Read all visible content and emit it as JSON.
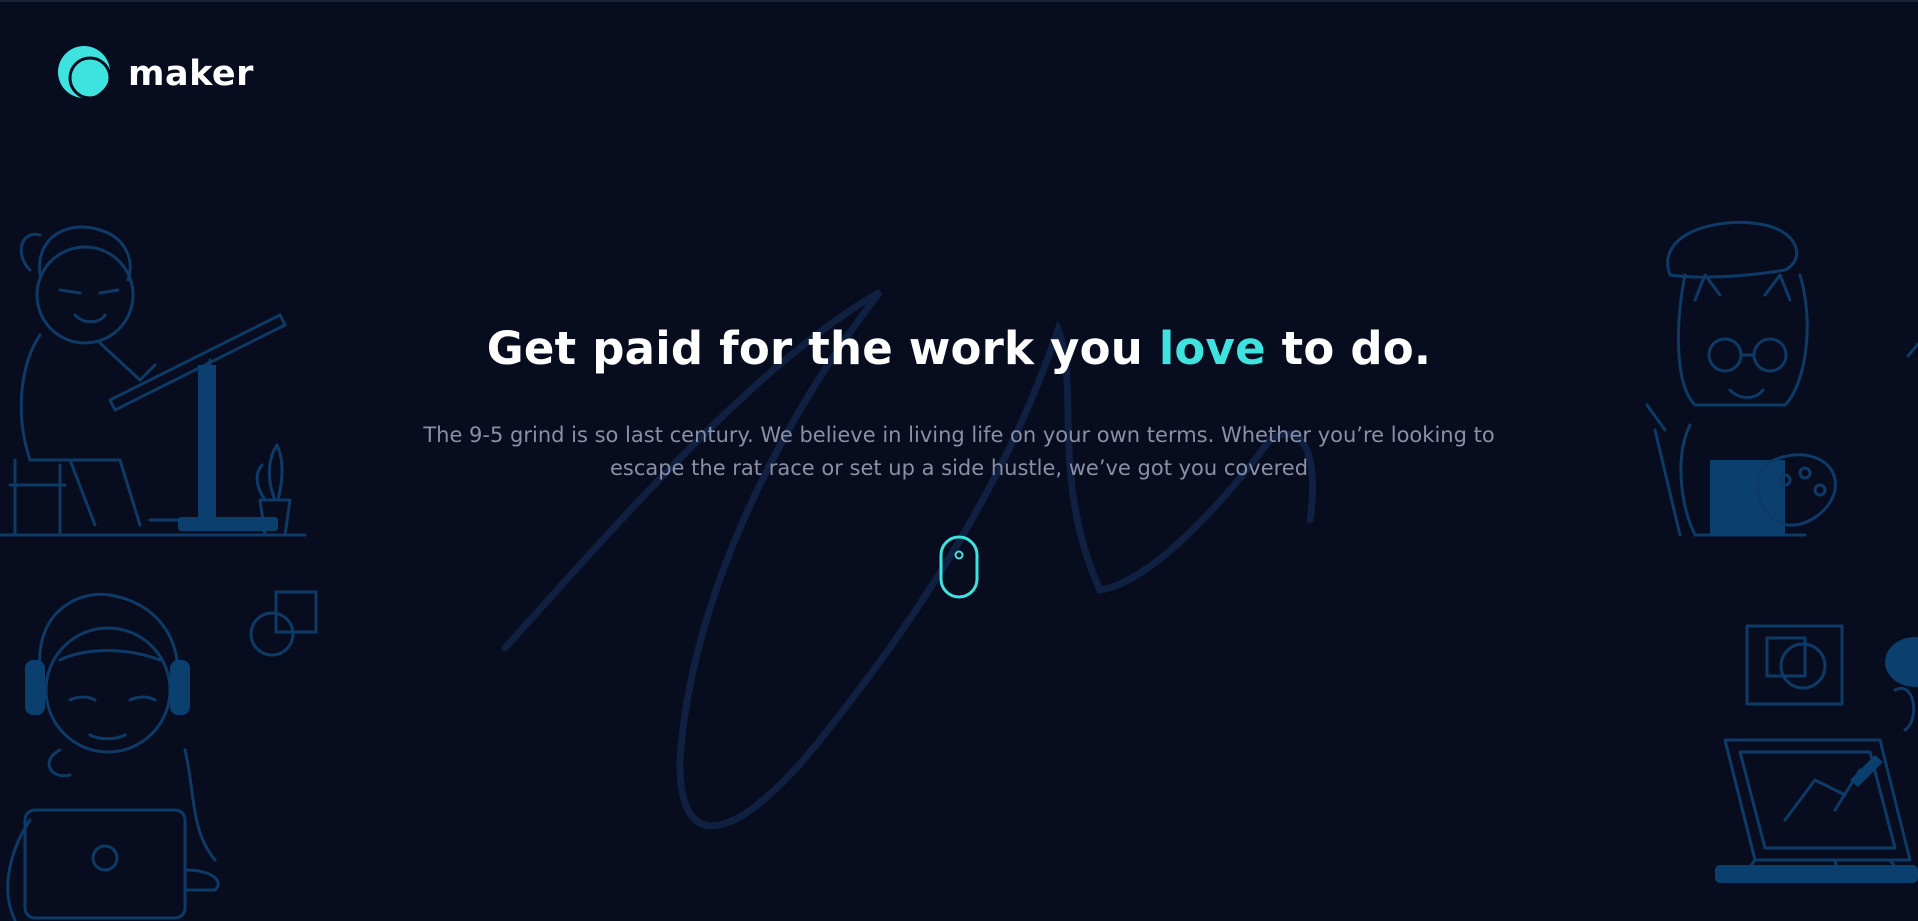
{
  "brand": {
    "name": "maker",
    "logo_icon": "maker-logo-icon",
    "accent_color": "#3ee3e0"
  },
  "hero": {
    "headline_before": "Get paid for the work you ",
    "headline_accent": "love",
    "headline_after": " to do.",
    "subtext": "The 9-5 grind is so last century. We believe in living life on your own terms. Whether you’re looking to escape the rat race or set up a side hustle, we’ve got you covered"
  },
  "scroll_indicator": {
    "icon": "mouse-scroll-icon"
  },
  "colors": {
    "background": "#070c1f",
    "illustration_stroke": "#0e3a66",
    "illustration_fill": "#0b3f6e",
    "headline": "#ffffff",
    "subtext": "#8a8fa6"
  }
}
